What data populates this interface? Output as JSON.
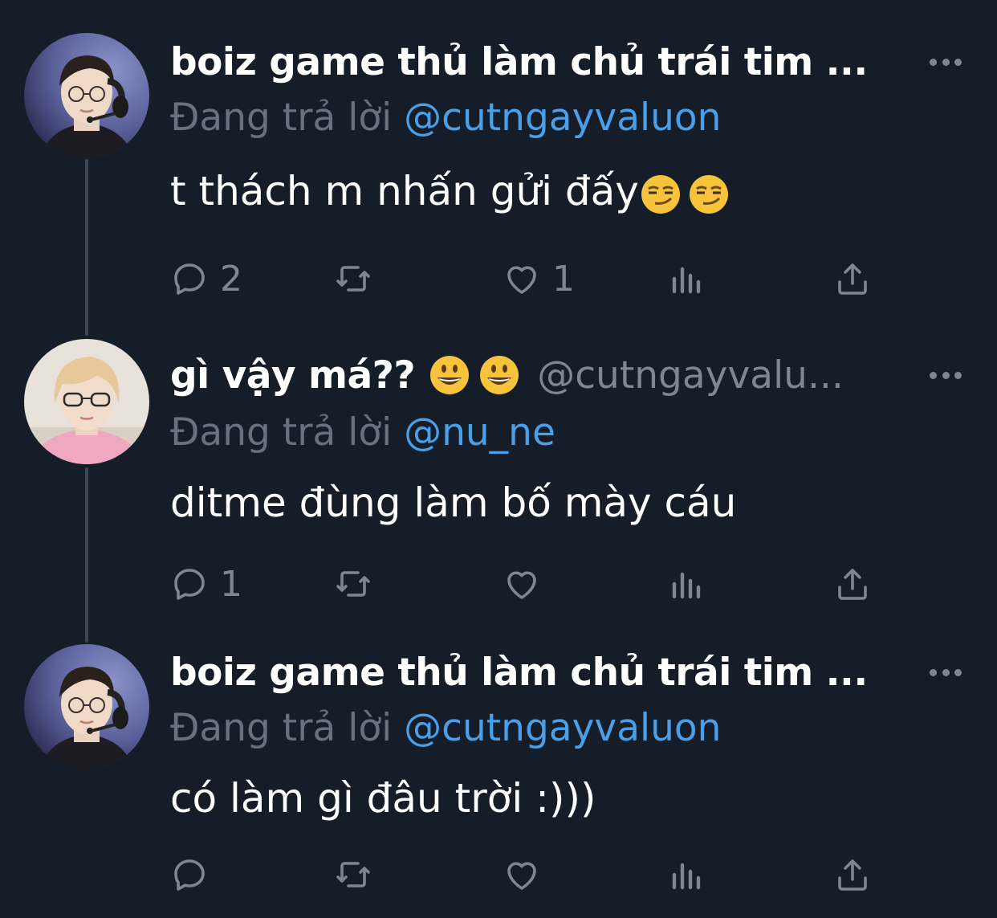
{
  "colors": {
    "background": "#151d28",
    "text_primary": "#ffffff",
    "text_secondary": "#7c8792",
    "mention": "#4a9fe8",
    "thread_line": "#3d4751"
  },
  "reply_prefix": "Đang trả lời",
  "tweets": [
    {
      "display_name": "boiz game thủ làm chủ trái tim ...",
      "handle": "",
      "emoji": [
        "smirking-face",
        "smirking-face"
      ],
      "reply_to": "@cutngayvaluon",
      "text": "t thách m nhấn gửi đấy",
      "replies": "2",
      "retweets": "",
      "likes": "1"
    },
    {
      "display_name": "gì vậy má??",
      "name_emoji": [
        "grinning-face",
        "grinning-face"
      ],
      "handle": "@cutngayvalu...",
      "reply_to": "@nu_ne",
      "text": "ditme đùng làm bố mày cáu",
      "replies": "1",
      "retweets": "",
      "likes": ""
    },
    {
      "display_name": "boiz game thủ làm chủ trái tim ...",
      "handle": "",
      "reply_to": "@cutngayvaluon",
      "text": "có làm gì đâu trời :)))",
      "replies": "",
      "retweets": "",
      "likes": ""
    }
  ]
}
